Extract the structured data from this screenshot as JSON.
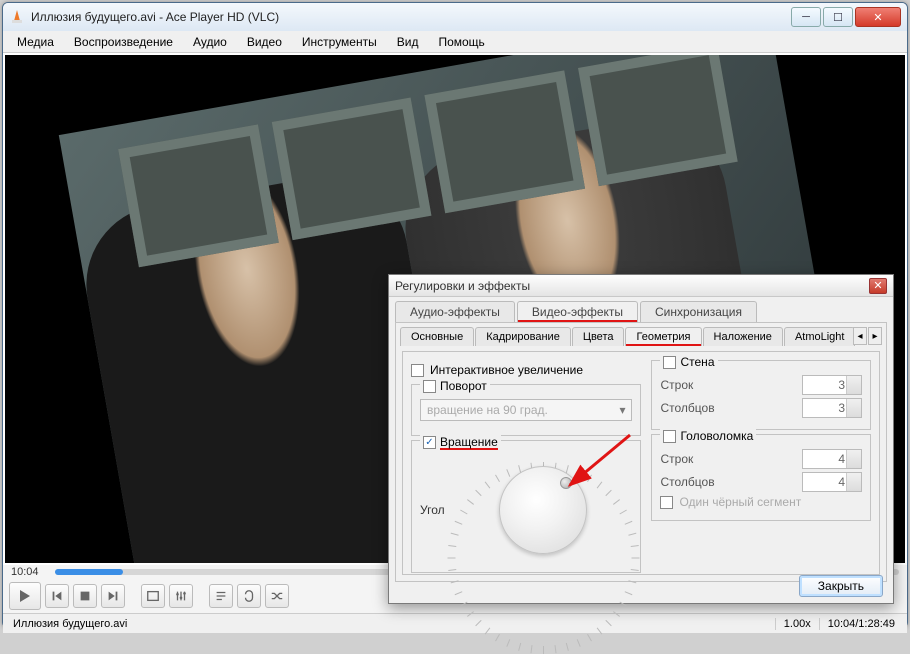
{
  "window": {
    "title": "Иллюзия будущего.avi - Ace Player HD (VLC)"
  },
  "menu": {
    "items": [
      "Медиа",
      "Воспроизведение",
      "Аудио",
      "Видео",
      "Инструменты",
      "Вид",
      "Помощь"
    ]
  },
  "seek": {
    "elapsed": "10:04"
  },
  "status": {
    "file": "Иллюзия будущего.avi",
    "speed": "1.00x",
    "time": "10:04/1:28:49"
  },
  "dialog": {
    "title": "Регулировки и эффекты",
    "tabs1": {
      "items": [
        "Аудио-эффекты",
        "Видео-эффекты",
        "Синхронизация"
      ],
      "active": 1
    },
    "tabs2": {
      "items": [
        "Основные",
        "Кадрирование",
        "Цвета",
        "Геометрия",
        "Наложение",
        "AtmoLight"
      ],
      "active": 3
    },
    "left": {
      "interactive_zoom": "Интерактивное увеличение",
      "rotate_cb": "Поворот",
      "rotate_select": "вращение на 90 град.",
      "rotation_cb": "Вращение",
      "angle": "Угол"
    },
    "wall": {
      "title": "Стена",
      "rows": "Строк",
      "cols": "Столбцов",
      "rows_val": "3",
      "cols_val": "3"
    },
    "puzzle": {
      "title": "Головоломка",
      "rows": "Строк",
      "cols": "Столбцов",
      "rows_val": "4",
      "cols_val": "4",
      "one_black": "Один чёрный сегмент"
    },
    "close_btn": "Закрыть"
  }
}
